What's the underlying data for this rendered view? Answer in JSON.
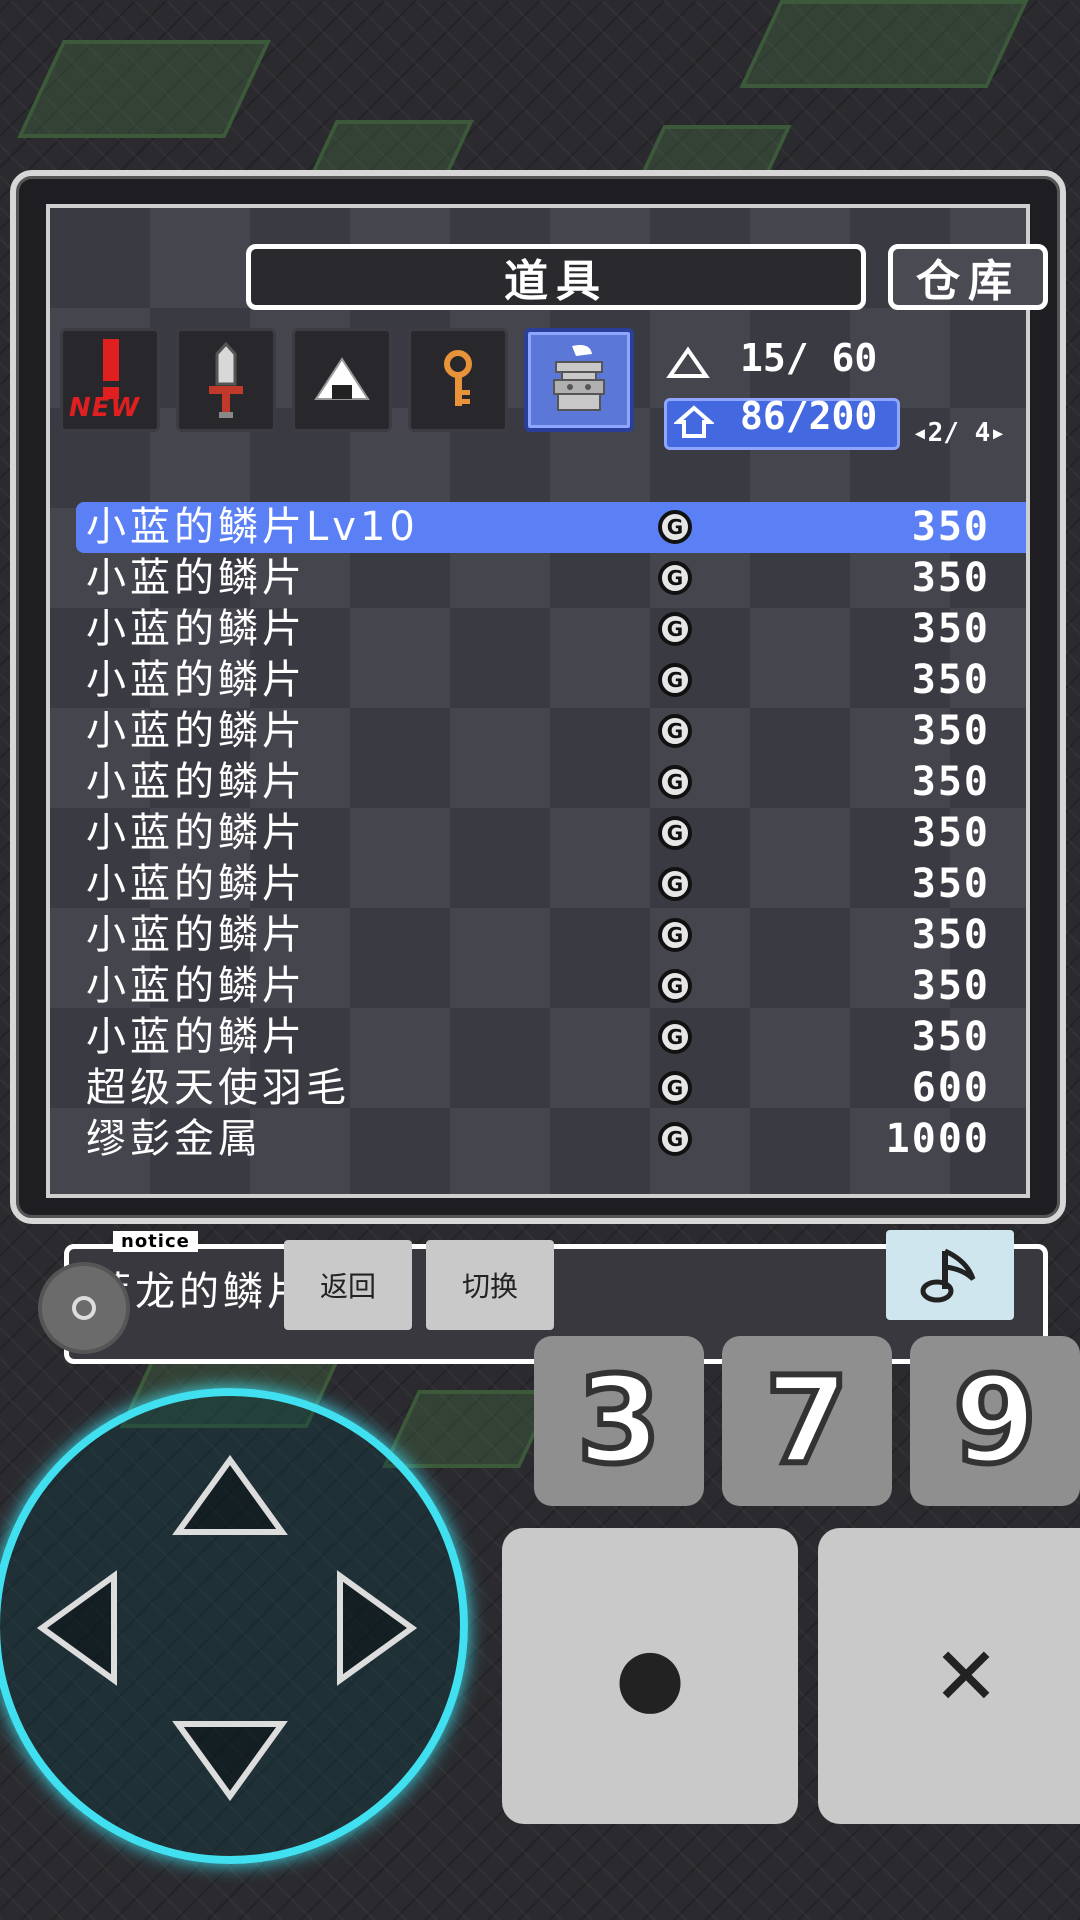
{
  "window": {
    "title": "道具",
    "storage_label": "仓库",
    "tabs": [
      {
        "name": "new",
        "label": "NEW"
      },
      {
        "name": "sword"
      },
      {
        "name": "riceball"
      },
      {
        "name": "key"
      },
      {
        "name": "jar",
        "active": true
      }
    ],
    "counters": {
      "food": "15/ 60",
      "items": "86/200",
      "page": "2/ 4"
    },
    "items": [
      {
        "name": "小蓝的鳞片Lv10",
        "price": "350",
        "selected": true
      },
      {
        "name": "小蓝的鳞片",
        "price": "350"
      },
      {
        "name": "小蓝的鳞片",
        "price": "350"
      },
      {
        "name": "小蓝的鳞片",
        "price": "350"
      },
      {
        "name": "小蓝的鳞片",
        "price": "350"
      },
      {
        "name": "小蓝的鳞片",
        "price": "350"
      },
      {
        "name": "小蓝的鳞片",
        "price": "350"
      },
      {
        "name": "小蓝的鳞片",
        "price": "350"
      },
      {
        "name": "小蓝的鳞片",
        "price": "350"
      },
      {
        "name": "小蓝的鳞片",
        "price": "350"
      },
      {
        "name": "小蓝的鳞片",
        "price": "350"
      },
      {
        "name": "超级天使羽毛",
        "price": "600"
      },
      {
        "name": "缪彭金属",
        "price": "1000"
      }
    ],
    "coin_symbol": "G",
    "notice_label": "notice",
    "notice_text": "蓝龙的鳞片。"
  },
  "controls": {
    "back_label": "返回",
    "switch_label": "切换",
    "num_buttons": [
      "3",
      "7",
      "9"
    ],
    "confirm_symbol": "●",
    "cancel_symbol": "✕",
    "music_icon": "music-note-icon",
    "settings_icon": "gear-icon",
    "dpad_color": "#40e0f0",
    "highlight_color": "#5b80f6"
  }
}
